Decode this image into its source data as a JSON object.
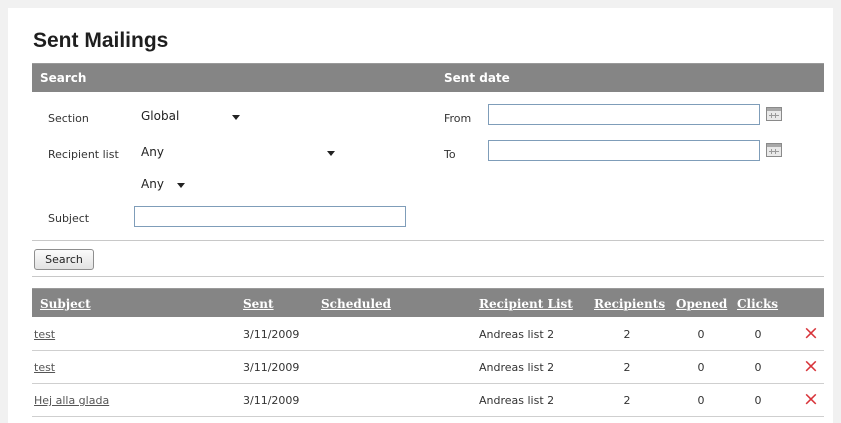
{
  "page": {
    "title": "Sent Mailings"
  },
  "search_panel": {
    "search_heading": "Search",
    "date_heading": "Sent date",
    "section_label": "Section",
    "section_value": "Global",
    "recipient_list_label": "Recipient list",
    "recipient_list_value": "Any",
    "secondary_filter_value": "Any",
    "subject_label": "Subject",
    "subject_value": "",
    "from_label": "From",
    "from_value": "",
    "to_label": "To",
    "to_value": "",
    "search_button": "Search"
  },
  "table": {
    "headers": {
      "subject": "Subject",
      "sent": "Sent",
      "scheduled": "Scheduled",
      "recipient_list": "Recipient List",
      "recipients": "Recipients",
      "opened": "Opened",
      "clicks": "Clicks"
    },
    "rows": [
      {
        "subject": "test",
        "sent": "3/11/2009",
        "scheduled": "",
        "recipient_list": "Andreas list 2",
        "recipients": "2",
        "opened": "0",
        "clicks": "0"
      },
      {
        "subject": "test",
        "sent": "3/11/2009",
        "scheduled": "",
        "recipient_list": "Andreas list 2",
        "recipients": "2",
        "opened": "0",
        "clicks": "0"
      },
      {
        "subject": "Hej alla glada",
        "sent": "3/11/2009",
        "scheduled": "",
        "recipient_list": "Andreas list 2",
        "recipients": "2",
        "opened": "0",
        "clicks": "0"
      }
    ],
    "delete_icon": "×"
  },
  "colors": {
    "header_band": "#858585",
    "delete": "#d8343a",
    "input_border": "#7f9db9"
  }
}
